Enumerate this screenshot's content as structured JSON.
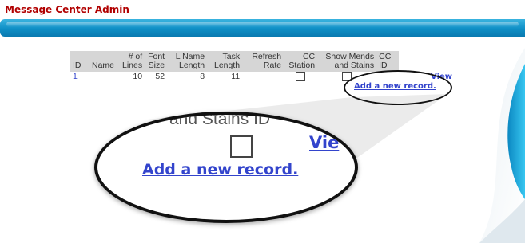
{
  "app": {
    "title": "Message Center Admin"
  },
  "table": {
    "columns": [
      {
        "key": "id",
        "label": "ID"
      },
      {
        "key": "name",
        "label": "Name"
      },
      {
        "key": "lines",
        "label": "# of Lines"
      },
      {
        "key": "font_size",
        "label": "Font Size"
      },
      {
        "key": "l_name_length",
        "label": "L Name Length"
      },
      {
        "key": "task_length",
        "label": "Task Length"
      },
      {
        "key": "refresh_rate",
        "label": "Refresh Rate"
      },
      {
        "key": "cc_station",
        "label": "CC Station"
      },
      {
        "key": "show_mends",
        "label": "Show Mends and Stains"
      },
      {
        "key": "cc_id",
        "label": "CC ID"
      }
    ],
    "rows": [
      {
        "id": "1",
        "name": "",
        "lines": "10",
        "font_size": "52",
        "l_name_length": "8",
        "task_length": "11",
        "refresh_rate": "",
        "cc_station": false,
        "show_mends": false,
        "cc_id": ""
      }
    ],
    "view_label": "View",
    "add_label": "Add a new record."
  },
  "zoom": {
    "header_text": "and Stains  ID",
    "view_text": "Vie",
    "add_text": "Add a new record."
  },
  "colors": {
    "title": "#b10000",
    "header_bar": "#0f8fc6",
    "link": "#3344cc",
    "table_header_bg": "#d6d6d6"
  }
}
